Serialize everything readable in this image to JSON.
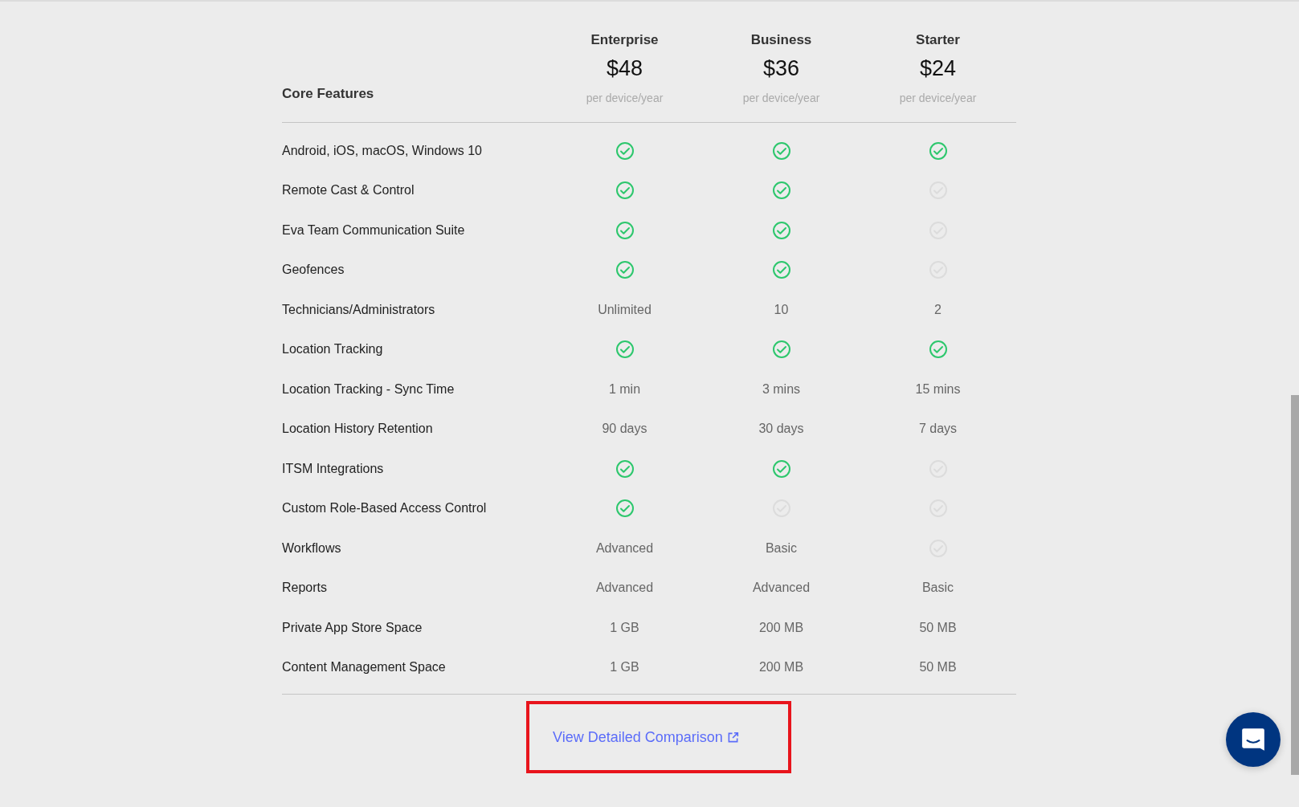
{
  "header": {
    "label": "Core Features",
    "plans": [
      {
        "name": "Enterprise",
        "price": "$48",
        "period": "per device/year"
      },
      {
        "name": "Business",
        "price": "$36",
        "period": "per device/year"
      },
      {
        "name": "Starter",
        "price": "$24",
        "period": "per device/year"
      }
    ]
  },
  "rows": [
    {
      "feature": "Android, iOS, macOS, Windows 10",
      "cells": [
        {
          "kind": "check",
          "included": true
        },
        {
          "kind": "check",
          "included": true
        },
        {
          "kind": "check",
          "included": true
        }
      ]
    },
    {
      "feature": "Remote Cast & Control",
      "cells": [
        {
          "kind": "check",
          "included": true
        },
        {
          "kind": "check",
          "included": true
        },
        {
          "kind": "check",
          "included": false
        }
      ]
    },
    {
      "feature": "Eva Team Communication Suite",
      "cells": [
        {
          "kind": "check",
          "included": true
        },
        {
          "kind": "check",
          "included": true
        },
        {
          "kind": "check",
          "included": false
        }
      ]
    },
    {
      "feature": "Geofences",
      "cells": [
        {
          "kind": "check",
          "included": true
        },
        {
          "kind": "check",
          "included": true
        },
        {
          "kind": "check",
          "included": false
        }
      ]
    },
    {
      "feature": "Technicians/Administrators",
      "cells": [
        {
          "kind": "text",
          "value": "Unlimited"
        },
        {
          "kind": "text",
          "value": "10"
        },
        {
          "kind": "text",
          "value": "2"
        }
      ]
    },
    {
      "feature": "Location Tracking",
      "cells": [
        {
          "kind": "check",
          "included": true
        },
        {
          "kind": "check",
          "included": true
        },
        {
          "kind": "check",
          "included": true
        }
      ]
    },
    {
      "feature": "Location Tracking - Sync Time",
      "cells": [
        {
          "kind": "text",
          "value": "1 min"
        },
        {
          "kind": "text",
          "value": "3 mins"
        },
        {
          "kind": "text",
          "value": "15 mins"
        }
      ]
    },
    {
      "feature": "Location History Retention",
      "cells": [
        {
          "kind": "text",
          "value": "90 days"
        },
        {
          "kind": "text",
          "value": "30 days"
        },
        {
          "kind": "text",
          "value": "7 days"
        }
      ]
    },
    {
      "feature": "ITSM Integrations",
      "cells": [
        {
          "kind": "check",
          "included": true
        },
        {
          "kind": "check",
          "included": true
        },
        {
          "kind": "check",
          "included": false
        }
      ]
    },
    {
      "feature": "Custom Role-Based Access Control",
      "cells": [
        {
          "kind": "check",
          "included": true
        },
        {
          "kind": "check",
          "included": false
        },
        {
          "kind": "check",
          "included": false
        }
      ]
    },
    {
      "feature": "Workflows",
      "cells": [
        {
          "kind": "text",
          "value": "Advanced"
        },
        {
          "kind": "text",
          "value": "Basic"
        },
        {
          "kind": "check",
          "included": false
        }
      ]
    },
    {
      "feature": "Reports",
      "cells": [
        {
          "kind": "text",
          "value": "Advanced"
        },
        {
          "kind": "text",
          "value": "Advanced"
        },
        {
          "kind": "text",
          "value": "Basic"
        }
      ]
    },
    {
      "feature": "Private App Store Space",
      "cells": [
        {
          "kind": "text",
          "value": "1 GB"
        },
        {
          "kind": "text",
          "value": "200 MB"
        },
        {
          "kind": "text",
          "value": "50 MB"
        }
      ]
    },
    {
      "feature": "Content Management Space",
      "cells": [
        {
          "kind": "text",
          "value": "1 GB"
        },
        {
          "kind": "text",
          "value": "200 MB"
        },
        {
          "kind": "text",
          "value": "50 MB"
        }
      ]
    }
  ],
  "link": {
    "label": "View Detailed Comparison"
  }
}
